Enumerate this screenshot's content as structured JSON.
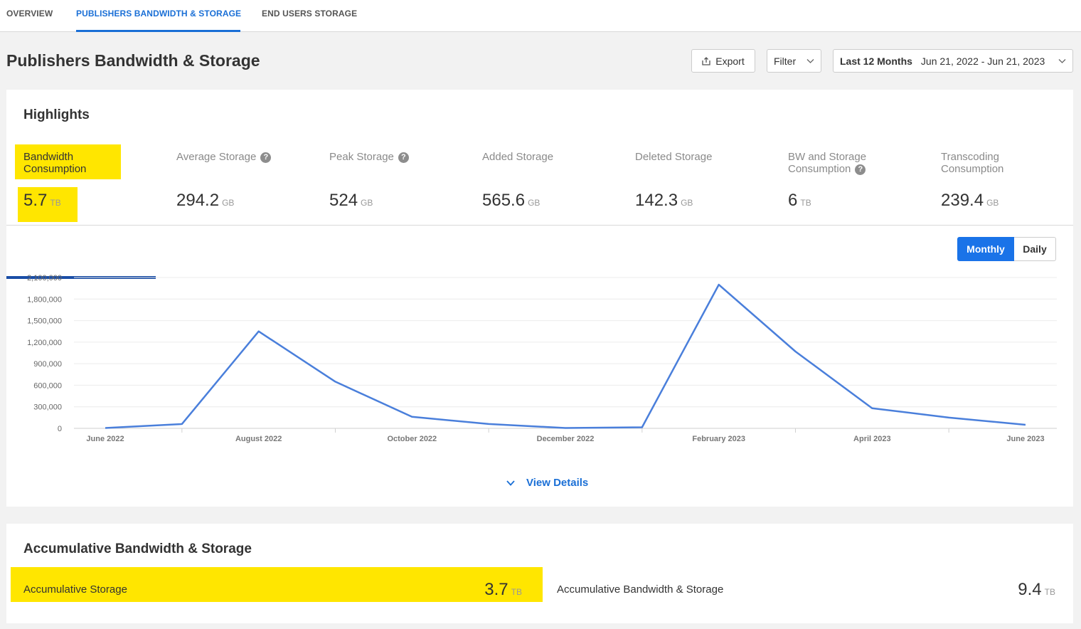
{
  "nav": {
    "tabs": [
      {
        "label": "OVERVIEW"
      },
      {
        "label": "PUBLISHERS BANDWIDTH & STORAGE"
      },
      {
        "label": "END USERS STORAGE"
      }
    ]
  },
  "page": {
    "title": "Publishers Bandwidth & Storage"
  },
  "toolbar": {
    "export_label": "Export",
    "filter_label": "Filter",
    "date_range_label": "Last 12 Months",
    "date_range_value": "Jun 21, 2022 - Jun 21, 2023"
  },
  "highlights": {
    "title": "Highlights",
    "metrics": [
      {
        "label": "Bandwidth Consumption",
        "value": "5.7",
        "unit": "TB"
      },
      {
        "label": "Average Storage",
        "value": "294.2",
        "unit": "GB",
        "help": "?"
      },
      {
        "label": "Peak Storage",
        "value": "524",
        "unit": "GB",
        "help": "?"
      },
      {
        "label": "Added Storage",
        "value": "565.6",
        "unit": "GB"
      },
      {
        "label": "Deleted Storage",
        "value": "142.3",
        "unit": "GB"
      },
      {
        "label": "BW and Storage Consumption",
        "value": "6",
        "unit": "TB",
        "help": "?"
      },
      {
        "label": "Transcoding Consumption",
        "value": "239.4",
        "unit": "GB"
      }
    ],
    "toggle": {
      "monthly": "Monthly",
      "daily": "Daily",
      "selected": "Monthly"
    },
    "view_details": "View Details"
  },
  "chart_data": {
    "type": "line",
    "x": [
      "June 2022",
      "July 2022",
      "August 2022",
      "September 2022",
      "October 2022",
      "November 2022",
      "December 2022",
      "January 2023",
      "February 2023",
      "March 2023",
      "April 2023",
      "May 2023",
      "June 2023"
    ],
    "x_tick_labels": [
      "June 2022",
      "August 2022",
      "October 2022",
      "December 2022",
      "February 2023",
      "April 2023",
      "June 2023"
    ],
    "series": [
      {
        "values": [
          5000,
          60000,
          1350000,
          650000,
          160000,
          60000,
          5000,
          15000,
          2000000,
          1070000,
          280000,
          150000,
          50000
        ],
        "color": "#4a7fdb"
      }
    ],
    "y_ticks": [
      "0",
      "300,000",
      "600,000",
      "900,000",
      "1,200,000",
      "1,500,000",
      "1,800,000",
      "2,100,000"
    ],
    "ylim": [
      0,
      2100000
    ],
    "grid": true
  },
  "accumulative": {
    "title": "Accumulative Bandwidth & Storage",
    "items": [
      {
        "label": "Accumulative Storage",
        "value": "3.7",
        "unit": "TB"
      },
      {
        "label": "Accumulative Bandwidth & Storage",
        "value": "9.4",
        "unit": "TB"
      }
    ]
  }
}
